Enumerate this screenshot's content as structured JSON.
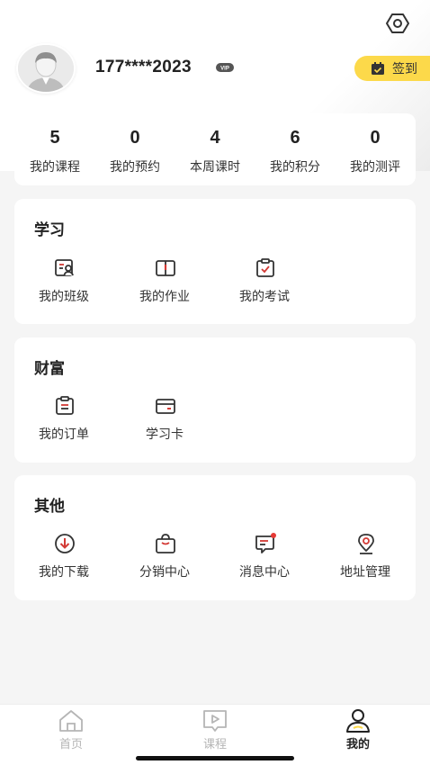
{
  "profile": {
    "phone": "177****2023",
    "vip_badge": "VIP",
    "sign_in_label": "签到"
  },
  "stats": [
    {
      "value": "5",
      "label": "我的课程"
    },
    {
      "value": "0",
      "label": "我的预约"
    },
    {
      "value": "4",
      "label": "本周课时"
    },
    {
      "value": "6",
      "label": "我的积分"
    },
    {
      "value": "0",
      "label": "我的测评"
    }
  ],
  "study": {
    "title": "学习",
    "items": [
      {
        "label": "我的班级",
        "icon": "class-icon"
      },
      {
        "label": "我的作业",
        "icon": "homework-icon"
      },
      {
        "label": "我的考试",
        "icon": "exam-icon"
      }
    ]
  },
  "wealth": {
    "title": "财富",
    "items": [
      {
        "label": "我的订单",
        "icon": "order-icon"
      },
      {
        "label": "学习卡",
        "icon": "study-card-icon"
      }
    ]
  },
  "other": {
    "title": "其他",
    "items": [
      {
        "label": "我的下载",
        "icon": "download-icon"
      },
      {
        "label": "分销中心",
        "icon": "distribution-icon"
      },
      {
        "label": "消息中心",
        "icon": "message-icon"
      },
      {
        "label": "地址管理",
        "icon": "address-icon"
      }
    ]
  },
  "tabs": [
    {
      "label": "首页",
      "icon": "home-icon",
      "active": false
    },
    {
      "label": "课程",
      "icon": "course-icon",
      "active": false
    },
    {
      "label": "我的",
      "icon": "profile-icon",
      "active": true
    }
  ],
  "colors": {
    "accent_red": "#d33a35",
    "sign_in_yellow": "#fcd94a",
    "inactive_tab": "#b5b5b5",
    "active_tab": "#222222"
  }
}
